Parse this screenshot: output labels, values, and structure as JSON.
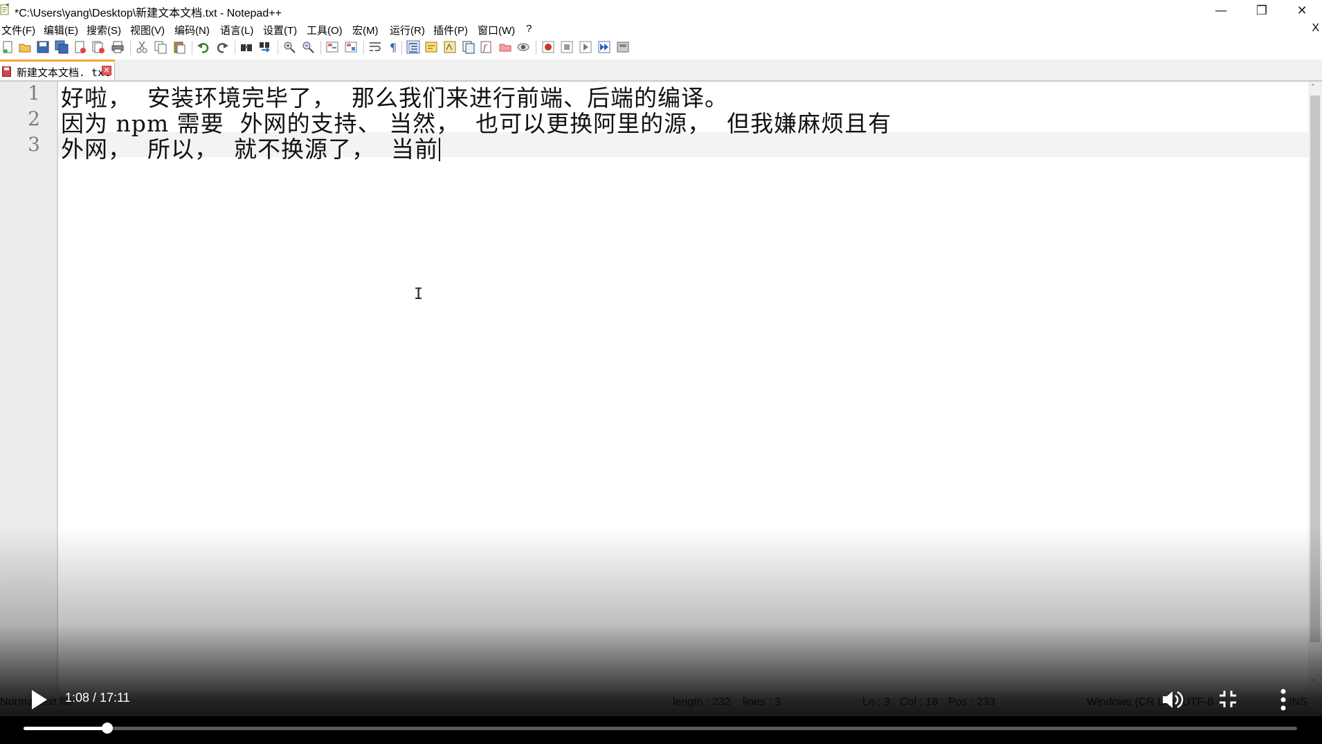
{
  "window": {
    "title": "*C:\\Users\\yang\\Desktop\\新建文本文档.txt - Notepad++",
    "minimize": "—",
    "restore": "❐",
    "close": "✕"
  },
  "menu": {
    "items": [
      "文件(F)",
      "编辑(E)",
      "搜索(S)",
      "视图(V)",
      "编码(N)",
      "语言(L)",
      "设置(T)",
      "工具(O)",
      "宏(M)",
      "运行(R)",
      "插件(P)",
      "窗口(W)",
      "?"
    ],
    "close_doc": "X"
  },
  "tab": {
    "label": "新建文本文档. txt",
    "close": "✕"
  },
  "editor": {
    "line_numbers": [
      "1",
      "2",
      "3"
    ],
    "lines": [
      "好啦，  安装环境完毕了，  那么我们来进行前端、后端的编译。",
      "因为 npm 需要  外网的支持、 当然，  也可以更换阿里的源，  但我嫌麻烦且有",
      "外网，  所以，  就不换源了，  当前"
    ]
  },
  "statusbar": {
    "mode": "Normal text file",
    "length": "length : 232",
    "lines": "lines : 3",
    "ln": "Ln : 3",
    "col": "Col : 18",
    "pos": "Pos : 233",
    "eol": "Windows (CR LF)",
    "encoding": "UTF-8",
    "ins": "INS"
  },
  "player": {
    "time": "1:08 / 17:11",
    "progress_fraction": 0.066
  },
  "colors": {
    "tab_accent": "#f5a33c",
    "gutter_bg": "#ececec",
    "current_line": "#f3f3f3"
  }
}
